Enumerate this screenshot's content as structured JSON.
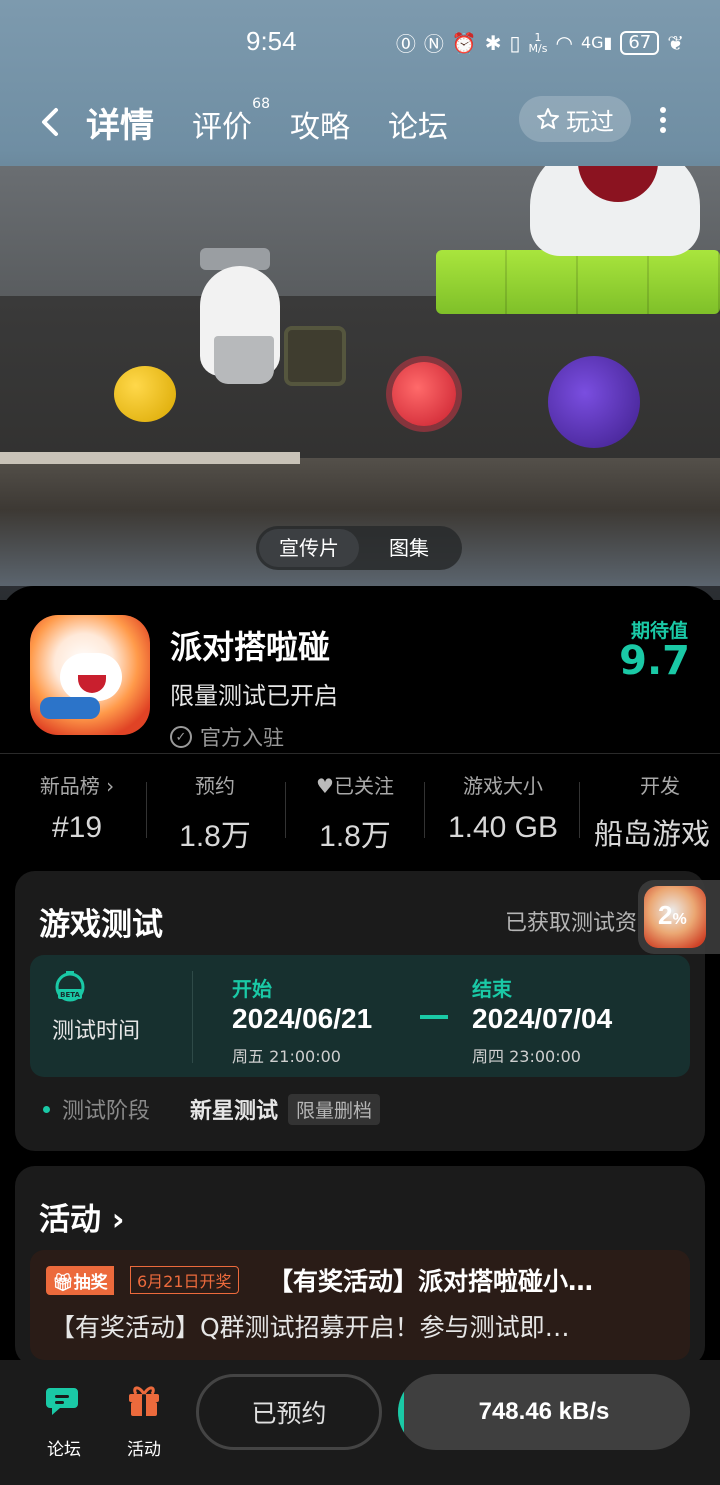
{
  "status_bar": {
    "time": "9:54",
    "net_speed_top": "1",
    "net_speed_unit": "M/s",
    "signal": "4G",
    "battery": "67"
  },
  "nav": {
    "tabs": [
      {
        "label": "详情",
        "active": true
      },
      {
        "label": "评价",
        "badge": "68"
      },
      {
        "label": "攻略"
      },
      {
        "label": "论坛"
      }
    ],
    "played_label": "玩过"
  },
  "banner": {
    "media_tabs": [
      "宣传片",
      "图集"
    ],
    "active_media_tab": "宣传片"
  },
  "app": {
    "name": "派对搭啦碰",
    "subtitle": "限量测试已开启",
    "official": "官方入驻",
    "expect_label": "期待值",
    "expect_value": "9.7"
  },
  "stats": [
    {
      "label": "新品榜 ›",
      "value": "#19"
    },
    {
      "label": "预约",
      "value": "1.8万"
    },
    {
      "label": "已关注",
      "value": "1.8万"
    },
    {
      "label": "游戏大小",
      "value": "1.40 GB"
    },
    {
      "label": "开发",
      "value": "船岛游戏"
    }
  ],
  "test": {
    "title": "游戏测试",
    "right_text": "已获取测试资",
    "float_pct": "2",
    "float_pct_unit": "%",
    "time_label": "测试时间",
    "icon_text": "BETA",
    "start_label": "开始",
    "start_date": "2024/06/21",
    "start_sub": "周五  21:00:00",
    "end_label": "结束",
    "end_date": "2024/07/04",
    "end_sub": "周四  23:00:00",
    "stage_label": "测试阶段",
    "stage_value": "新星测试",
    "stage_tag": "限量删档"
  },
  "activity": {
    "title": "活动 ›",
    "tag": "抽奖",
    "date_tag": "6月21日开奖",
    "headline": "【有奖活动】派对搭啦碰小…",
    "line2": "【有奖活动】Q群测试招募开启！参与测试即…"
  },
  "bottom": {
    "forum": "论坛",
    "activity": "活动",
    "reserved": "已预约",
    "download_speed": "748.46 kB/s",
    "download_progress": 0.02
  },
  "colors": {
    "accent": "#1ac9a6",
    "orange": "#ec6a3c",
    "card": "#1b1b1b"
  }
}
